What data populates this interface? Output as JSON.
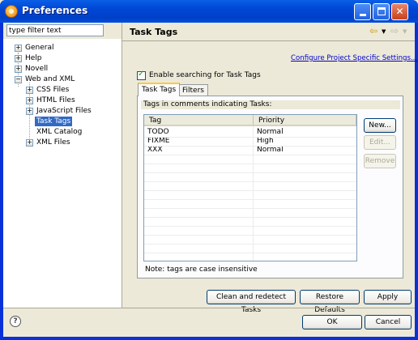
{
  "window": {
    "title": "Preferences",
    "minimize_icon": "minimize-icon",
    "maximize_icon": "maximize-icon",
    "close_icon": "close-icon"
  },
  "filter": {
    "placeholder": "type filter text"
  },
  "tree": {
    "items": [
      {
        "label": "General",
        "expander": "+"
      },
      {
        "label": "Help",
        "expander": "+"
      },
      {
        "label": "Novell",
        "expander": "+"
      },
      {
        "label": "Web and XML",
        "expander": "−"
      },
      {
        "label": "CSS Files",
        "expander": "+"
      },
      {
        "label": "HTML Files",
        "expander": "+"
      },
      {
        "label": "JavaScript Files",
        "expander": "+"
      },
      {
        "label": "Task Tags",
        "selected": true
      },
      {
        "label": "XML Catalog"
      },
      {
        "label": "XML Files",
        "expander": "+"
      }
    ]
  },
  "page": {
    "title": "Task Tags",
    "back_icon": "back-arrow-icon",
    "forward_icon": "forward-arrow-icon",
    "configure_link": "Configure Project Specific Settings...",
    "enable_label": "Enable searching for Task Tags",
    "enable_checked": true,
    "tabs": [
      {
        "label": "Task Tags",
        "active": true
      },
      {
        "label": "Filters"
      }
    ],
    "group_label": "Tags in comments indicating Tasks:",
    "table": {
      "columns": [
        "Tag",
        "Priority"
      ],
      "rows": [
        [
          "TODO",
          "Normal"
        ],
        [
          "FIXME",
          "High"
        ],
        [
          "XXX",
          "Normal"
        ]
      ]
    },
    "side_buttons": {
      "new": "New...",
      "edit": "Edit...",
      "remove": "Remove"
    },
    "note": "Note: tags are case insensitive",
    "buttons": {
      "clean": "Clean and redetect Tasks",
      "restore": "Restore Defaults",
      "apply": "Apply"
    }
  },
  "footer": {
    "help_icon": "help-icon",
    "ok": "OK",
    "cancel": "Cancel"
  },
  "colors": {
    "selection": "#316ac5",
    "link": "#0000cc",
    "titlebar": "#0046d5"
  }
}
